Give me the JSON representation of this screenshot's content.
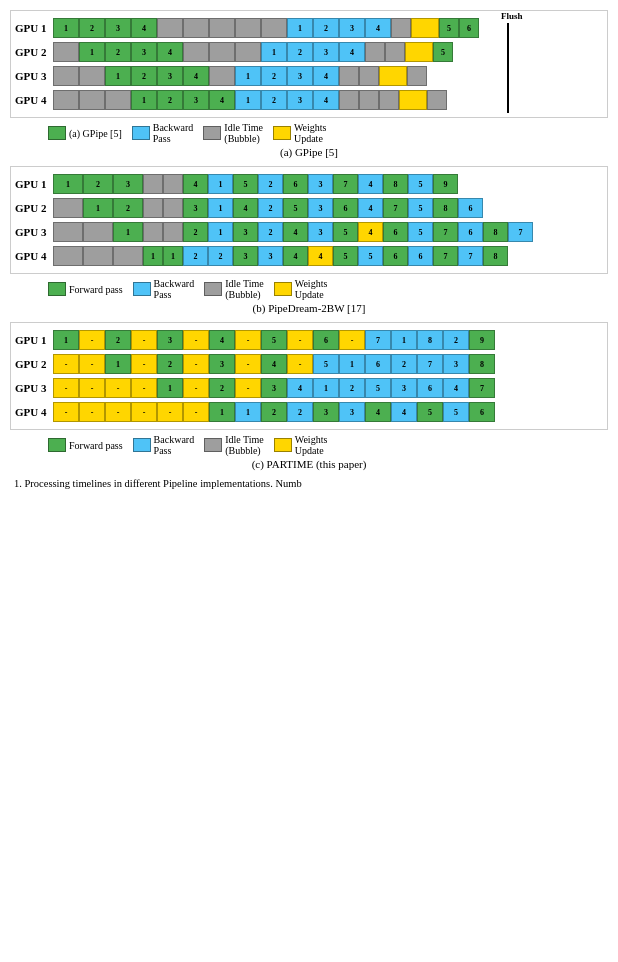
{
  "sections": [
    {
      "id": "gpipe",
      "caption": "(a) GPipe [5]",
      "flush": true,
      "flush_label": "Flush",
      "gpu_rows": [
        {
          "label": "GPU 1",
          "cells": [
            {
              "type": "green",
              "text": "1"
            },
            {
              "type": "green",
              "text": "2"
            },
            {
              "type": "green",
              "text": "3"
            },
            {
              "type": "green",
              "text": "4"
            },
            {
              "type": "gray",
              "text": ""
            },
            {
              "type": "gray",
              "text": ""
            },
            {
              "type": "gray",
              "text": ""
            },
            {
              "type": "gray",
              "text": ""
            },
            {
              "type": "gray",
              "text": ""
            },
            {
              "type": "blue",
              "text": "1"
            },
            {
              "type": "blue",
              "text": "2"
            },
            {
              "type": "blue",
              "text": "3"
            },
            {
              "type": "blue",
              "text": "4"
            },
            {
              "type": "gray",
              "text": ""
            },
            {
              "type": "gray",
              "text": ""
            },
            {
              "type": "yellow",
              "text": ""
            },
            {
              "type": "green",
              "text": "5"
            },
            {
              "type": "green",
              "text": "6"
            }
          ]
        },
        {
          "label": "GPU 2",
          "cells": [
            {
              "type": "gray",
              "text": ""
            },
            {
              "type": "green",
              "text": "1"
            },
            {
              "type": "green",
              "text": "2"
            },
            {
              "type": "green",
              "text": "3"
            },
            {
              "type": "green",
              "text": "4"
            },
            {
              "type": "gray",
              "text": ""
            },
            {
              "type": "gray",
              "text": ""
            },
            {
              "type": "gray",
              "text": ""
            },
            {
              "type": "blue",
              "text": "1"
            },
            {
              "type": "blue",
              "text": "2"
            },
            {
              "type": "blue",
              "text": "3"
            },
            {
              "type": "blue",
              "text": "4"
            },
            {
              "type": "gray",
              "text": ""
            },
            {
              "type": "gray",
              "text": ""
            },
            {
              "type": "gray",
              "text": ""
            },
            {
              "type": "yellow",
              "text": ""
            },
            {
              "type": "green",
              "text": "5"
            }
          ]
        },
        {
          "label": "GPU 3",
          "cells": [
            {
              "type": "gray",
              "text": ""
            },
            {
              "type": "gray",
              "text": ""
            },
            {
              "type": "green",
              "text": "1"
            },
            {
              "type": "green",
              "text": "2"
            },
            {
              "type": "green",
              "text": "3"
            },
            {
              "type": "green",
              "text": "4"
            },
            {
              "type": "gray",
              "text": ""
            },
            {
              "type": "blue",
              "text": "1"
            },
            {
              "type": "blue",
              "text": "2"
            },
            {
              "type": "blue",
              "text": "3"
            },
            {
              "type": "blue",
              "text": "4"
            },
            {
              "type": "gray",
              "text": ""
            },
            {
              "type": "gray",
              "text": ""
            },
            {
              "type": "gray",
              "text": ""
            },
            {
              "type": "gray",
              "text": ""
            },
            {
              "type": "yellow",
              "text": ""
            },
            {
              "type": "gray",
              "text": ""
            }
          ]
        },
        {
          "label": "GPU 4",
          "cells": [
            {
              "type": "gray",
              "text": ""
            },
            {
              "type": "gray",
              "text": ""
            },
            {
              "type": "gray",
              "text": ""
            },
            {
              "type": "green",
              "text": "1"
            },
            {
              "type": "green",
              "text": "2"
            },
            {
              "type": "green",
              "text": "3"
            },
            {
              "type": "green",
              "text": "4"
            },
            {
              "type": "blue",
              "text": "1"
            },
            {
              "type": "blue",
              "text": "2"
            },
            {
              "type": "blue",
              "text": "3"
            },
            {
              "type": "blue",
              "text": "4"
            },
            {
              "type": "gray",
              "text": ""
            },
            {
              "type": "gray",
              "text": ""
            },
            {
              "type": "gray",
              "text": ""
            },
            {
              "type": "gray",
              "text": ""
            },
            {
              "type": "gray",
              "text": ""
            },
            {
              "type": "yellow",
              "text": ""
            },
            {
              "type": "gray",
              "text": ""
            }
          ]
        }
      ]
    },
    {
      "id": "pipedream",
      "caption": "(b) PipeDream-2BW [17]",
      "flush": false,
      "gpu_rows": [
        {
          "label": "GPU 1",
          "cells": [
            {
              "type": "green",
              "text": "1"
            },
            {
              "type": "green",
              "text": "2"
            },
            {
              "type": "green",
              "text": "3"
            },
            {
              "type": "gray",
              "text": ""
            },
            {
              "type": "gray",
              "text": ""
            },
            {
              "type": "green",
              "text": "4"
            },
            {
              "type": "blue",
              "text": "1"
            },
            {
              "type": "green",
              "text": "5"
            },
            {
              "type": "blue",
              "text": "2"
            },
            {
              "type": "green",
              "text": "6"
            },
            {
              "type": "blue",
              "text": "3"
            },
            {
              "type": "green",
              "text": "7"
            },
            {
              "type": "blue",
              "text": "4"
            },
            {
              "type": "green",
              "text": "8"
            },
            {
              "type": "blue",
              "text": "5"
            },
            {
              "type": "green",
              "text": "9"
            }
          ]
        },
        {
          "label": "GPU 2",
          "cells": [
            {
              "type": "gray",
              "text": ""
            },
            {
              "type": "green",
              "text": "1"
            },
            {
              "type": "green",
              "text": "2"
            },
            {
              "type": "gray",
              "text": ""
            },
            {
              "type": "gray",
              "text": ""
            },
            {
              "type": "green",
              "text": "3"
            },
            {
              "type": "blue",
              "text": "1"
            },
            {
              "type": "green",
              "text": "4"
            },
            {
              "type": "blue",
              "text": "2"
            },
            {
              "type": "green",
              "text": "5"
            },
            {
              "type": "blue",
              "text": "3"
            },
            {
              "type": "green",
              "text": "6"
            },
            {
              "type": "blue",
              "text": "4"
            },
            {
              "type": "green",
              "text": "7"
            },
            {
              "type": "blue",
              "text": "5"
            },
            {
              "type": "green",
              "text": "8"
            },
            {
              "type": "blue",
              "text": "6"
            }
          ]
        },
        {
          "label": "GPU 3",
          "cells": [
            {
              "type": "gray",
              "text": ""
            },
            {
              "type": "gray",
              "text": ""
            },
            {
              "type": "green",
              "text": "1"
            },
            {
              "type": "gray",
              "text": ""
            },
            {
              "type": "gray",
              "text": ""
            },
            {
              "type": "green",
              "text": "2"
            },
            {
              "type": "blue",
              "text": "1"
            },
            {
              "type": "green",
              "text": "3"
            },
            {
              "type": "blue",
              "text": "2"
            },
            {
              "type": "green",
              "text": "4"
            },
            {
              "type": "blue",
              "text": "3"
            },
            {
              "type": "green",
              "text": "5"
            },
            {
              "type": "yellow",
              "text": "4"
            },
            {
              "type": "green",
              "text": "6"
            },
            {
              "type": "blue",
              "text": "5"
            },
            {
              "type": "green",
              "text": "7"
            },
            {
              "type": "blue",
              "text": "6"
            },
            {
              "type": "green",
              "text": "8"
            },
            {
              "type": "blue",
              "text": "7"
            }
          ]
        },
        {
          "label": "GPU 4",
          "cells": [
            {
              "type": "gray",
              "text": ""
            },
            {
              "type": "gray",
              "text": ""
            },
            {
              "type": "gray",
              "text": ""
            },
            {
              "type": "green",
              "text": "1"
            },
            {
              "type": "green",
              "text": "1"
            },
            {
              "type": "blue",
              "text": "2"
            },
            {
              "type": "blue",
              "text": "2"
            },
            {
              "type": "green",
              "text": "3"
            },
            {
              "type": "blue",
              "text": "3"
            },
            {
              "type": "green",
              "text": "4"
            },
            {
              "type": "yellow",
              "text": "4"
            },
            {
              "type": "green",
              "text": "5"
            },
            {
              "type": "blue",
              "text": "5"
            },
            {
              "type": "green",
              "text": "6"
            },
            {
              "type": "blue",
              "text": "6"
            },
            {
              "type": "green",
              "text": "7"
            },
            {
              "type": "blue",
              "text": "7"
            },
            {
              "type": "green",
              "text": "8"
            }
          ]
        }
      ]
    },
    {
      "id": "partime",
      "caption": "(c) PARTIME (this paper)",
      "flush": false,
      "gpu_rows": [
        {
          "label": "GPU 1",
          "cells": [
            {
              "type": "green",
              "text": "1"
            },
            {
              "type": "yellow",
              "text": "-"
            },
            {
              "type": "green",
              "text": "2"
            },
            {
              "type": "yellow",
              "text": "-"
            },
            {
              "type": "green",
              "text": "3"
            },
            {
              "type": "yellow",
              "text": "-"
            },
            {
              "type": "green",
              "text": "4"
            },
            {
              "type": "yellow",
              "text": "-"
            },
            {
              "type": "green",
              "text": "5"
            },
            {
              "type": "yellow",
              "text": "-"
            },
            {
              "type": "green",
              "text": "6"
            },
            {
              "type": "yellow",
              "text": "-"
            },
            {
              "type": "blue",
              "text": "7"
            },
            {
              "type": "blue",
              "text": "1"
            },
            {
              "type": "blue",
              "text": "8"
            },
            {
              "type": "blue",
              "text": "2"
            },
            {
              "type": "green",
              "text": "9"
            }
          ]
        },
        {
          "label": "GPU 2",
          "cells": [
            {
              "type": "yellow",
              "text": "-"
            },
            {
              "type": "yellow",
              "text": "-"
            },
            {
              "type": "green",
              "text": "1"
            },
            {
              "type": "yellow",
              "text": "-"
            },
            {
              "type": "green",
              "text": "2"
            },
            {
              "type": "yellow",
              "text": "-"
            },
            {
              "type": "green",
              "text": "3"
            },
            {
              "type": "yellow",
              "text": "-"
            },
            {
              "type": "green",
              "text": "4"
            },
            {
              "type": "yellow",
              "text": "-"
            },
            {
              "type": "blue",
              "text": "5"
            },
            {
              "type": "blue",
              "text": "1"
            },
            {
              "type": "blue",
              "text": "6"
            },
            {
              "type": "blue",
              "text": "2"
            },
            {
              "type": "blue",
              "text": "7"
            },
            {
              "type": "blue",
              "text": "3"
            },
            {
              "type": "green",
              "text": "8"
            }
          ]
        },
        {
          "label": "GPU 3",
          "cells": [
            {
              "type": "yellow",
              "text": "-"
            },
            {
              "type": "yellow",
              "text": "-"
            },
            {
              "type": "yellow",
              "text": "-"
            },
            {
              "type": "yellow",
              "text": "-"
            },
            {
              "type": "green",
              "text": "1"
            },
            {
              "type": "yellow",
              "text": "-"
            },
            {
              "type": "green",
              "text": "2"
            },
            {
              "type": "yellow",
              "text": "-"
            },
            {
              "type": "green",
              "text": "3"
            },
            {
              "type": "blue",
              "text": "4"
            },
            {
              "type": "blue",
              "text": "1"
            },
            {
              "type": "blue",
              "text": "2"
            },
            {
              "type": "blue",
              "text": "5"
            },
            {
              "type": "blue",
              "text": "3"
            },
            {
              "type": "blue",
              "text": "6"
            },
            {
              "type": "blue",
              "text": "4"
            },
            {
              "type": "green",
              "text": "7"
            }
          ]
        },
        {
          "label": "GPU 4",
          "cells": [
            {
              "type": "yellow",
              "text": "-"
            },
            {
              "type": "yellow",
              "text": "-"
            },
            {
              "type": "yellow",
              "text": "-"
            },
            {
              "type": "yellow",
              "text": "-"
            },
            {
              "type": "yellow",
              "text": "-"
            },
            {
              "type": "yellow",
              "text": "-"
            },
            {
              "type": "green",
              "text": "1"
            },
            {
              "type": "blue",
              "text": "1"
            },
            {
              "type": "green",
              "text": "2"
            },
            {
              "type": "blue",
              "text": "2"
            },
            {
              "type": "green",
              "text": "3"
            },
            {
              "type": "blue",
              "text": "3"
            },
            {
              "type": "green",
              "text": "4"
            },
            {
              "type": "blue",
              "text": "4"
            },
            {
              "type": "green",
              "text": "5"
            },
            {
              "type": "blue",
              "text": "5"
            },
            {
              "type": "green",
              "text": "6"
            }
          ]
        }
      ]
    }
  ],
  "legend": {
    "items": [
      {
        "label": "Forward pass",
        "type": "green"
      },
      {
        "label": "Backward Pass",
        "type": "blue"
      },
      {
        "label": "Idle Time (Bubble)",
        "type": "gray"
      },
      {
        "label": "Weights Update",
        "type": "yellow"
      }
    ]
  },
  "figure_caption": "1. Processing timelines in different Pipeline implementations. Numb"
}
